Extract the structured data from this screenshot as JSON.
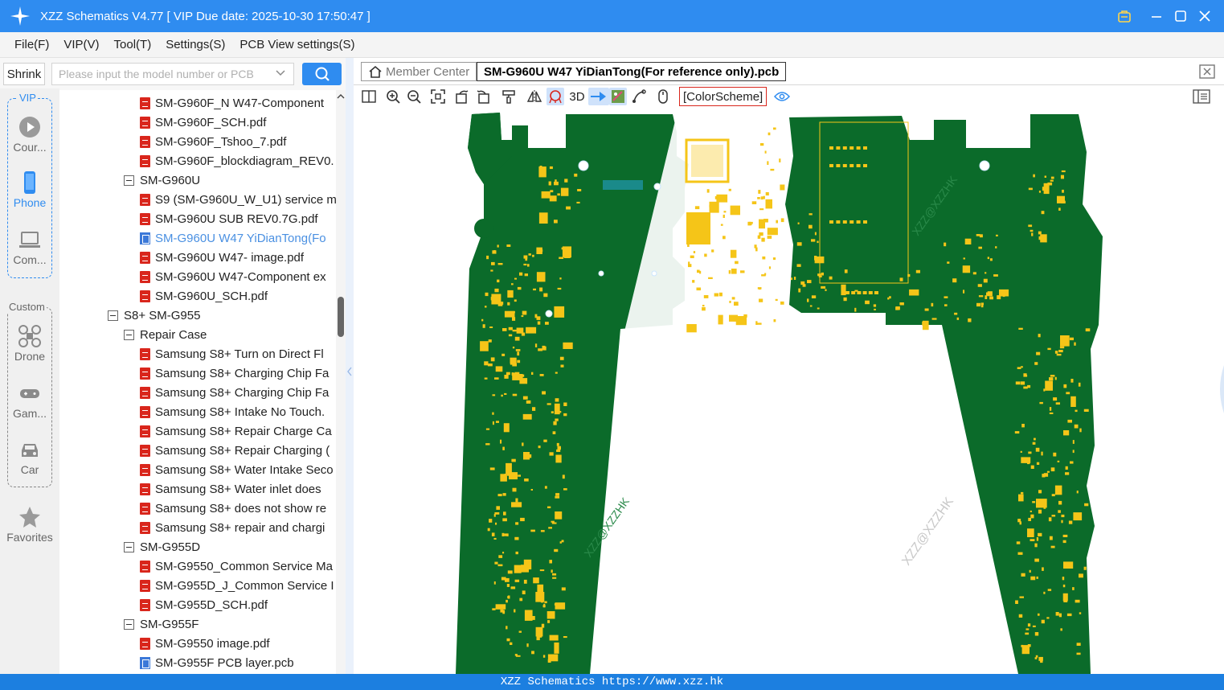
{
  "window": {
    "title": "XZZ Schematics V4.77 [ VIP Due date: 2025-10-30 17:50:47 ]",
    "accent": "#2f8cf0"
  },
  "menu": [
    "File(F)",
    "VIP(V)",
    "Tool(T)",
    "Settings(S)",
    "PCB View settings(S)"
  ],
  "search": {
    "shrink_label": "Shrink",
    "placeholder": "Please input the model number or PCB"
  },
  "rail": {
    "vip_label": "VIP",
    "custom_label": "Custom",
    "items": [
      {
        "label": "Cour...",
        "icon": "play-circle-icon"
      },
      {
        "label": "Phone",
        "icon": "phone-icon"
      },
      {
        "label": "Com...",
        "icon": "laptop-icon"
      },
      {
        "label": "Drone",
        "icon": "drone-icon"
      },
      {
        "label": "Gam...",
        "icon": "gamepad-icon"
      },
      {
        "label": "Car",
        "icon": "car-icon"
      },
      {
        "label": "Favorites",
        "icon": "star-icon"
      }
    ]
  },
  "tree": [
    {
      "label": "SM-G960F_N W47-Component",
      "kind": "pdf",
      "level": 2
    },
    {
      "label": "SM-G960F_SCH.pdf",
      "kind": "pdf",
      "level": 2
    },
    {
      "label": "SM-G960F_Tshoo_7.pdf",
      "kind": "pdf",
      "level": 2
    },
    {
      "label": "SM-G960F_blockdiagram_REV0.",
      "kind": "pdf",
      "level": 2
    },
    {
      "label": "SM-G960U",
      "kind": "folder",
      "level": 1
    },
    {
      "label": "S9 (SM-G960U_W_U1) service m",
      "kind": "pdf",
      "level": 2
    },
    {
      "label": "SM-G960U SUB REV0.7G.pdf",
      "kind": "pdf",
      "level": 2
    },
    {
      "label": "SM-G960U W47 YiDianTong(Fo",
      "kind": "pcb",
      "level": 2,
      "selected": true
    },
    {
      "label": "SM-G960U W47- image.pdf",
      "kind": "pdf",
      "level": 2
    },
    {
      "label": "SM-G960U W47-Component ex",
      "kind": "pdf",
      "level": 2
    },
    {
      "label": "SM-G960U_SCH.pdf",
      "kind": "pdf",
      "level": 2
    },
    {
      "label": "S8+ SM-G955",
      "kind": "folder",
      "level": 0
    },
    {
      "label": "Repair Case",
      "kind": "folder",
      "level": 1
    },
    {
      "label": "Samsung S8+  Turn on Direct Fl",
      "kind": "pdf",
      "level": 2
    },
    {
      "label": "Samsung S8+ Charging Chip Fa",
      "kind": "pdf",
      "level": 2
    },
    {
      "label": "Samsung S8+ Charging Chip Fa",
      "kind": "pdf",
      "level": 2
    },
    {
      "label": "Samsung S8+ Intake No Touch.",
      "kind": "pdf",
      "level": 2
    },
    {
      "label": "Samsung S8+ Repair Charge Ca",
      "kind": "pdf",
      "level": 2
    },
    {
      "label": "Samsung S8+ Repair Charging (",
      "kind": "pdf",
      "level": 2
    },
    {
      "label": "Samsung S8+ Water Intake Seco",
      "kind": "pdf",
      "level": 2
    },
    {
      "label": "Samsung S8+ Water inlet does",
      "kind": "pdf",
      "level": 2
    },
    {
      "label": "Samsung S8+ does not show re",
      "kind": "pdf",
      "level": 2
    },
    {
      "label": "Samsung S8+ repair and chargi",
      "kind": "pdf",
      "level": 2
    },
    {
      "label": "SM-G955D",
      "kind": "folder",
      "level": 1
    },
    {
      "label": "SM-G9550_Common Service Ma",
      "kind": "pdf",
      "level": 2
    },
    {
      "label": "SM-G955D_J_Common Service I",
      "kind": "pdf",
      "level": 2
    },
    {
      "label": "SM-G955D_SCH.pdf",
      "kind": "pdf",
      "level": 2
    },
    {
      "label": "SM-G955F",
      "kind": "folder",
      "level": 1
    },
    {
      "label": "SM-G9550 image.pdf",
      "kind": "pdf",
      "level": 2
    },
    {
      "label": "SM-G955F PCB layer.pcb",
      "kind": "pcb",
      "level": 2
    }
  ],
  "tabs": {
    "member_center": "Member Center",
    "active": "SM-G960U W47 YiDianTong(For reference only).pcb"
  },
  "toolbar": {
    "three_d": "3D",
    "color_scheme": "[ColorScheme]"
  },
  "canvas": {
    "watermark": "XZZ@XZZHK",
    "board_color": "#0b6b2a",
    "pad_color": "#f5c518"
  },
  "footer": "XZZ Schematics https://www.xzz.hk"
}
